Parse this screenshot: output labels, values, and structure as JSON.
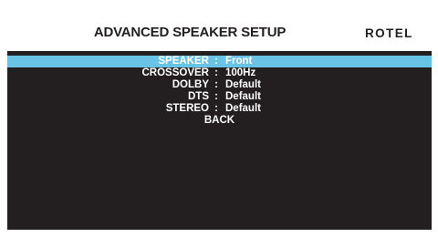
{
  "header": {
    "title": "ADVANCED SPEAKER SETUP",
    "logo_text": "ROTEL"
  },
  "menu": {
    "items": [
      {
        "label": "SPEAKER",
        "separator": ":",
        "value": "Front",
        "selected": true
      },
      {
        "label": "CROSSOVER",
        "separator": ":",
        "value": "100Hz",
        "selected": false
      },
      {
        "label": "DOLBY",
        "separator": ":",
        "value": "Default",
        "selected": false
      },
      {
        "label": "DTS",
        "separator": ":",
        "value": "Default",
        "selected": false
      },
      {
        "label": "STEREO",
        "separator": ":",
        "value": "Default",
        "selected": false
      }
    ],
    "back_label": "BACK"
  },
  "colors": {
    "background": "#231f20",
    "header_background": "#ffffff",
    "highlight": "#69c3e6",
    "text": "#ffffff"
  }
}
